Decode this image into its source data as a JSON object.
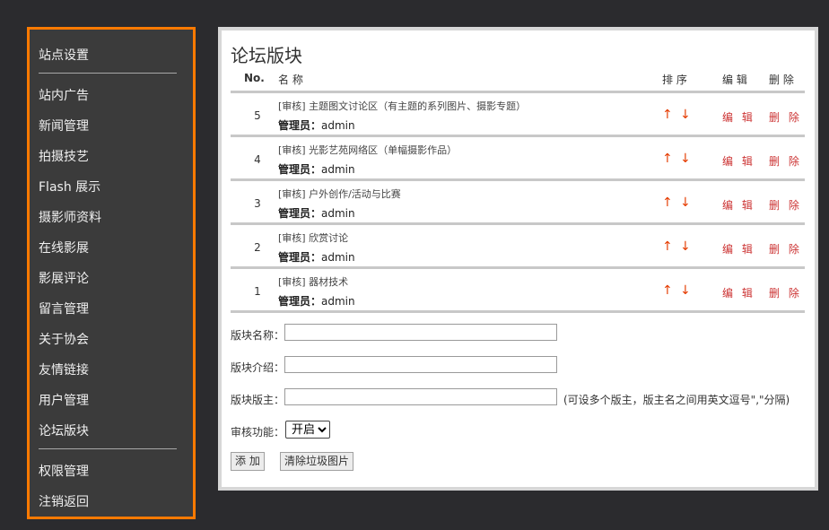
{
  "sidebar": {
    "group1": [
      "站点设置"
    ],
    "group2": [
      "站内广告",
      "新闻管理",
      "拍摄技艺",
      "Flash 展示",
      "摄影师资料",
      "在线影展",
      "影展评论",
      "留言管理",
      "关于协会",
      "友情链接",
      "用户管理",
      "论坛版块"
    ],
    "group3": [
      "权限管理",
      "注销返回"
    ]
  },
  "page": {
    "title": "论坛版块",
    "headers": {
      "no": "No.",
      "name": "名 称",
      "sort": "排 序",
      "edit": "编 辑",
      "delete": "删 除"
    },
    "rows": [
      {
        "no": "5",
        "name": "[审核] 主题图文讨论区（有主题的系列图片、摄影专题）",
        "admin_label": "管理员：",
        "admin": "admin",
        "up": "↑",
        "down": "↓",
        "edit": "编 辑",
        "delete": "删 除"
      },
      {
        "no": "4",
        "name": "[审核] 光影艺苑网络区（单幅摄影作品）",
        "admin_label": "管理员：",
        "admin": "admin",
        "up": "↑",
        "down": "↓",
        "edit": "编 辑",
        "delete": "删 除"
      },
      {
        "no": "3",
        "name": "[审核] 户外创作/活动与比赛",
        "admin_label": "管理员：",
        "admin": "admin",
        "up": "↑",
        "down": "↓",
        "edit": "编 辑",
        "delete": "删 除"
      },
      {
        "no": "2",
        "name": "[审核] 欣赏讨论",
        "admin_label": "管理员：",
        "admin": "admin",
        "up": "↑",
        "down": "↓",
        "edit": "编 辑",
        "delete": "删 除"
      },
      {
        "no": "1",
        "name": "[审核] 器材技术",
        "admin_label": "管理员：",
        "admin": "admin",
        "up": "↑",
        "down": "↓",
        "edit": "编 辑",
        "delete": "删 除"
      }
    ],
    "form": {
      "name_label": "版块名称：",
      "name_value": "",
      "intro_label": "版块介绍：",
      "intro_value": "",
      "owner_label": "版块版主：",
      "owner_value": "",
      "owner_hint": "(可设多个版主，版主名之间用英文逗号\",\"分隔)",
      "audit_label": "审核功能：",
      "audit_selected": "开启",
      "add_button": "添 加",
      "clean_button": "清除垃圾图片"
    }
  },
  "colors": {
    "sidebar_border": "#ff7a00",
    "sidebar_bg": "#3b3b3b",
    "action_red": "#cc3333",
    "arrow_red": "#e53b00"
  }
}
